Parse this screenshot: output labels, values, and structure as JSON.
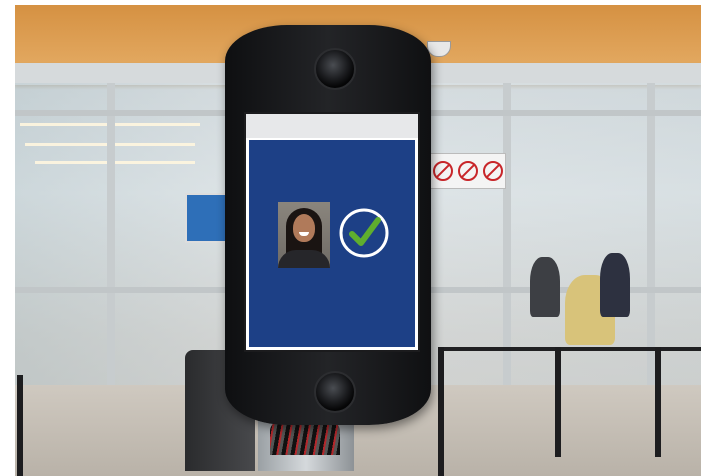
{
  "scene": {
    "description_free": true,
    "icons": [
      "camera-lens-icon",
      "camera-lens-icon",
      "checkmark-icon",
      "no-smoking-icon",
      "no-phone-icon",
      "no-entry-icon"
    ]
  },
  "kiosk_screen": {
    "header_text": "",
    "status": "verified",
    "status_color": "#5fae2e",
    "screen_color": "#1d4086"
  },
  "colors": {
    "kiosk_body": "#16171a",
    "sign_symbol": "#c8262a",
    "ceiling": "#d99a4e"
  }
}
